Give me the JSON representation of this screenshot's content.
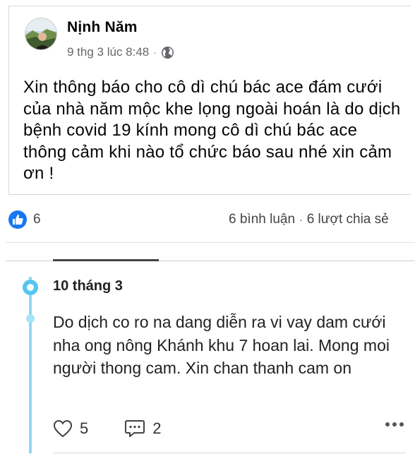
{
  "post": {
    "author": "Nịnh Năm",
    "timestamp": "9 thg 3 lúc 8:48",
    "separator": "·",
    "privacy_icon": "globe-icon",
    "text": "Xin thông báo cho cô dì chú bác ace đám cưới của nhà năm mộc khe lọng ngoài hoán là do dịch bệnh covid 19 kính mong cô dì chú bác ace thông cảm khi nào tổ chức báo sau nhé xin cảm ơn !",
    "reaction_icon": "like-icon",
    "reaction_count": "6",
    "comments": "6 bình luận",
    "shares": "6 lượt chia sẻ"
  },
  "comment": {
    "date": "10 tháng 3",
    "text": "Do dịch co ro na dang diễn ra vi vay dam cưới nha ong nông Khánh khu 7 hoan lai. Mong moi người thong cam. Xin chan thanh cam on",
    "likes": "5",
    "replies": "2",
    "icons": [
      "heart-icon",
      "comment-icon",
      "more-icon"
    ]
  },
  "colors": {
    "facebook_blue": "#1877f2",
    "secondary_text": "#65676b",
    "timeline_blue": "#54c6ef"
  }
}
